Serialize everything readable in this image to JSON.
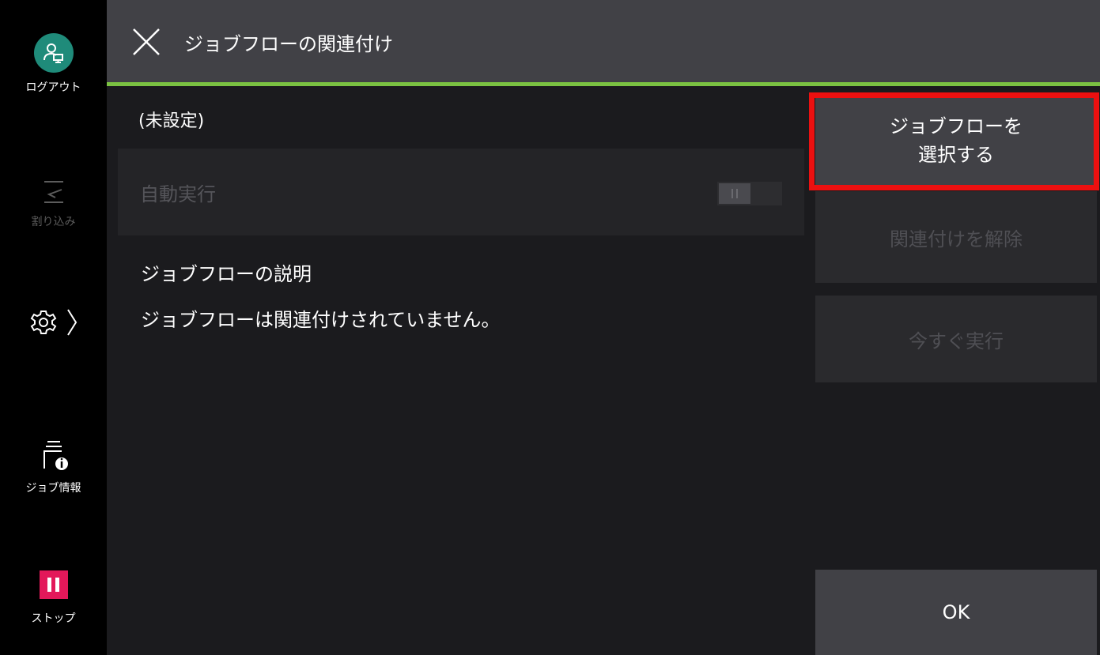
{
  "sidebar": {
    "logout_label": "ログアウト",
    "interrupt_label": "割り込み",
    "job_info_label": "ジョブ情報",
    "stop_label": "ストップ"
  },
  "header": {
    "title": "ジョブフローの関連付け"
  },
  "main": {
    "status": "(未設定)",
    "auto_run_label": "自動実行",
    "auto_run_enabled": false,
    "description_heading": "ジョブフローの説明",
    "description_text": "ジョブフローは関連付けされていません。"
  },
  "actions": {
    "select_line1": "ジョブフローを",
    "select_line2": "選択する",
    "unlink": "関連付けを解除",
    "run_now": "今すぐ実行",
    "ok": "OK"
  },
  "colors": {
    "accent_green": "#7bc242",
    "logout_teal": "#1f8b7a",
    "stop_pink": "#e3185a",
    "highlight_red": "#ec1010"
  },
  "icons": {
    "close": "close-icon",
    "logout": "user-logout-icon",
    "interrupt": "interrupt-icon",
    "settings": "gear-icon",
    "job_info": "job-info-icon",
    "stop": "pause-icon"
  }
}
